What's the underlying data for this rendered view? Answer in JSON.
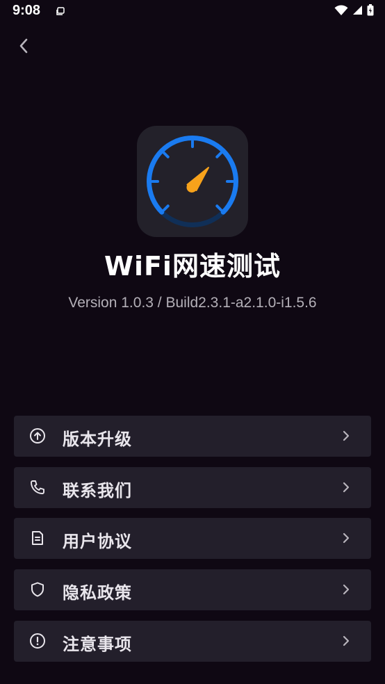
{
  "status_bar": {
    "time": "9:08"
  },
  "header": {
    "back_icon": "chevron-left-icon"
  },
  "app": {
    "name": "WiFi网速测试",
    "version": "Version 1.0.3 / Build2.3.1-a2.1.0-i1.5.6",
    "icon": "speedometer-icon"
  },
  "menu": {
    "items": [
      {
        "label": "版本升级",
        "icon": "arrow-up-circle-icon"
      },
      {
        "label": "联系我们",
        "icon": "phone-icon"
      },
      {
        "label": "用户协议",
        "icon": "document-icon"
      },
      {
        "label": "隐私政策",
        "icon": "shield-icon"
      },
      {
        "label": "注意事项",
        "icon": "alert-circle-icon"
      }
    ]
  },
  "colors": {
    "background": "#0f0813",
    "card": "#231f2b",
    "accent_blue": "#1a7bf0",
    "needle_orange": "#f7a21b"
  }
}
